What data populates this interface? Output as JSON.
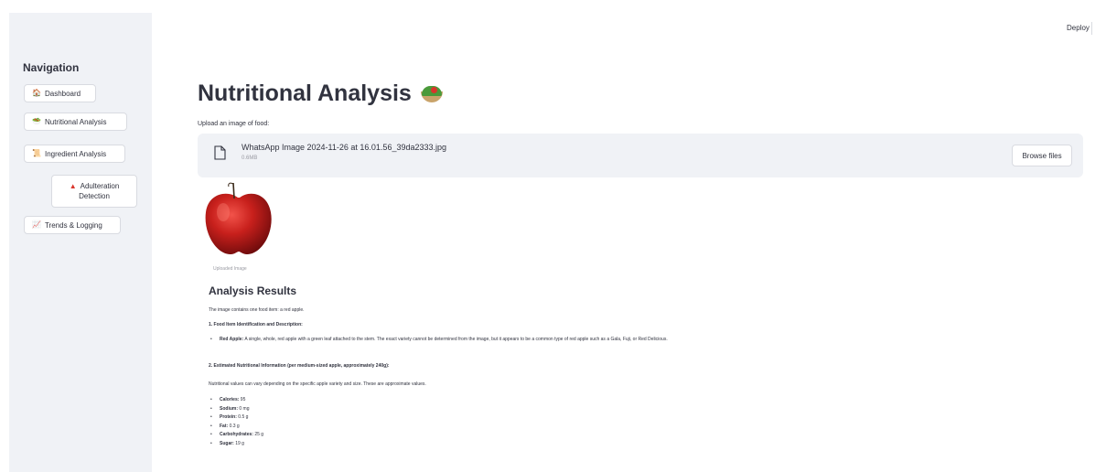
{
  "header": {
    "deploy_label": "Deploy"
  },
  "sidebar": {
    "heading": "Navigation",
    "items": [
      {
        "icon": "house-icon",
        "label": "Dashboard"
      },
      {
        "icon": "bowl-icon",
        "label": "Nutritional Analysis"
      },
      {
        "icon": "scroll-icon",
        "label": "Ingredient Analysis"
      },
      {
        "icon": "warning-icon",
        "label_line1": "Adulteration",
        "label_line2": "Detection"
      },
      {
        "icon": "chart-icon",
        "label": "Trends & Logging"
      }
    ]
  },
  "main": {
    "title": "Nutritional Analysis",
    "upload_label": "Upload an image of food:",
    "file": {
      "name": "WhatsApp Image 2024-11-26 at 16.01.56_39da2333.jpg",
      "size": "0.6MB"
    },
    "browse_label": "Browse files",
    "image_caption": "Uploaded Image",
    "results": {
      "heading": "Analysis Results",
      "intro": "The image contains one food item: a red apple.",
      "section1_title": "1. Food Item Identification and Description:",
      "section1_item_label": "Red Apple:",
      "section1_item_text": "A single, whole, red apple with a green leaf attached to the stem. The exact variety cannot be determined from the image, but it appears to be a common type of red apple such as a Gala, Fuji, or Red Delicious.",
      "section2_title": "2. Estimated Nutritional Information (per medium-sized apple, approximately 240g):",
      "section2_note": "Nutritional values can vary depending on the specific apple variety and size. These are approximate values.",
      "nutrients": [
        {
          "label": "Calories:",
          "value": "95"
        },
        {
          "label": "Sodium:",
          "value": "0 mg"
        },
        {
          "label": "Protein:",
          "value": "0.5 g"
        },
        {
          "label": "Fat:",
          "value": "0.3 g"
        },
        {
          "label": "Carbohydrates:",
          "value": "25 g"
        },
        {
          "label": "Sugar:",
          "value": "19 g"
        }
      ]
    }
  }
}
